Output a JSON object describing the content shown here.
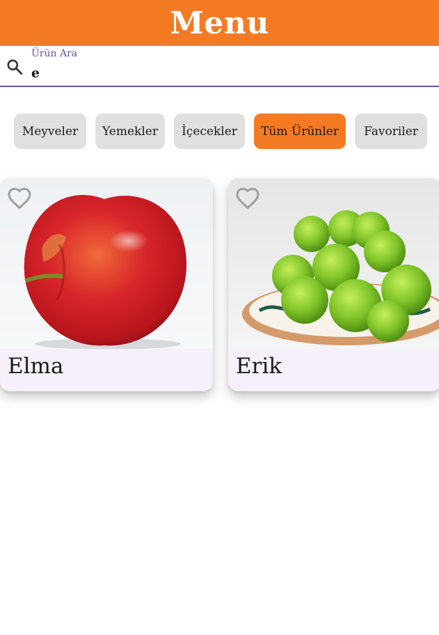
{
  "appbar": {
    "title": "Menu"
  },
  "search": {
    "label": "Ürün Ara",
    "value": "e",
    "icon": "search-icon"
  },
  "categories": [
    {
      "label": "Meyveler",
      "active": false
    },
    {
      "label": "Yemekler",
      "active": false
    },
    {
      "label": "İçecekler",
      "active": false
    },
    {
      "label": "Tüm Ürünler",
      "active": true
    },
    {
      "label": "Favoriler",
      "active": false
    }
  ],
  "products": [
    {
      "name": "Elma",
      "favorite": false,
      "image": "red apple"
    },
    {
      "name": "Erik",
      "favorite": false,
      "image": "green plums in bowl"
    }
  ],
  "colors": {
    "accent": "#F47A24",
    "primary": "#6A4FA2",
    "chip": "#E0E0E0",
    "card": "#F5F0F9"
  }
}
